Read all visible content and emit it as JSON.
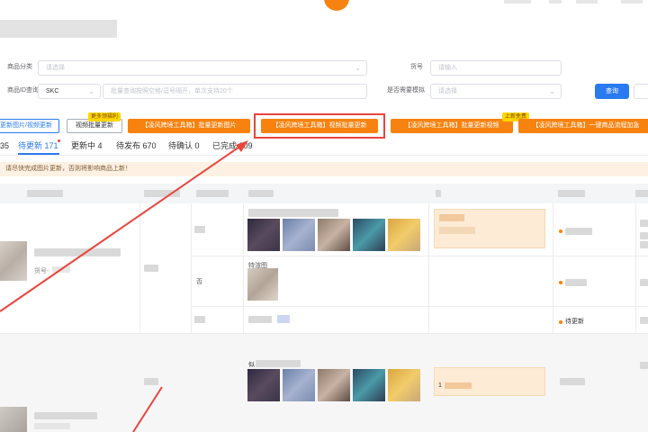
{
  "filters": {
    "category_label": "商品分类",
    "category_placeholder": "请选择",
    "sku_label": "货号",
    "sku_placeholder": "请输入",
    "query_label": "商品ID查询",
    "query_type_value": "SKC",
    "query_placeholder": "批量查询按照空格/逗号隔开，单次支持20个",
    "template_label": "是否需要模拟",
    "template_placeholder": "请选择",
    "search_button": "查询"
  },
  "toolbar": {
    "btn_image_video": "更新图片/视频更新",
    "btn_video_batch": "视频批量更新",
    "btn_video_batch_badge": "更多领福利",
    "btn_tool_image": "【凌风跨境工具箱】批量更新图片",
    "btn_tool_video": "【凌风跨境工具箱】视频批量更新",
    "btn_tool_video2": "【凌风跨境工具箱】批量更新视频",
    "btn_tool_video2_badge": "上新免费",
    "btn_tool_onekey": "【凌风跨境工具箱】一键商品流程加急"
  },
  "tabs": [
    {
      "label": "35"
    },
    {
      "label": "待更新 171"
    },
    {
      "label": "更新中 4"
    },
    {
      "label": "待发布 670"
    },
    {
      "label": "待确认 0"
    },
    {
      "label": "已完成 309"
    }
  ],
  "notice": "请尽快完成图片更新，否则将影响商品上新！",
  "rows": {
    "row1_sku_hint": "货号-",
    "row1_sub2_flag": "否",
    "row1_sub2_label": "特渲图",
    "row1_status": "待更新",
    "row2_label": "似",
    "row2_price": "1"
  },
  "colors": {
    "accent_orange": "#f7820f",
    "highlight_red": "#e8453c",
    "primary_blue": "#2a7af0",
    "tab_active": "#2a7af0"
  }
}
